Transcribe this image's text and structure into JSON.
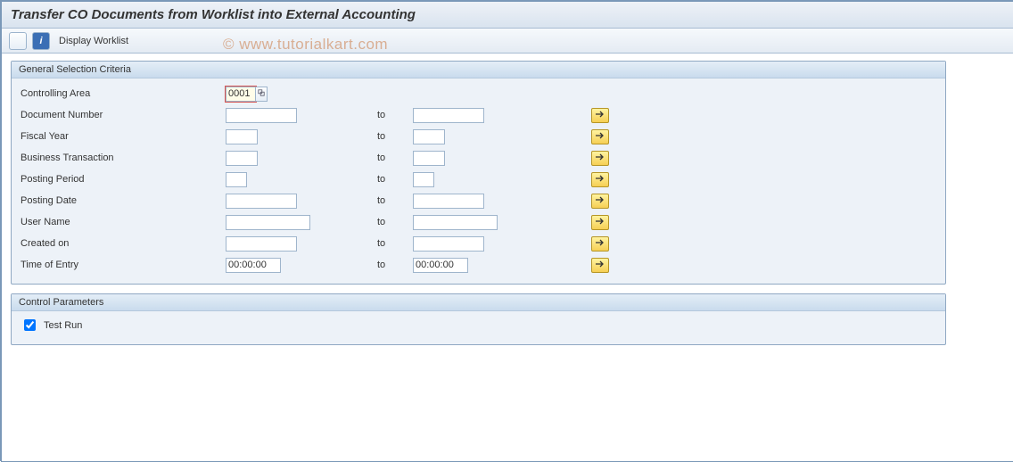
{
  "title": "Transfer CO Documents from Worklist into External Accounting",
  "watermark": "© www.tutorialkart.com",
  "toolbar": {
    "display_worklist": "Display Worklist"
  },
  "groups": {
    "general": {
      "title": "General Selection Criteria",
      "to_label": "to",
      "fields": {
        "controlling_area": {
          "label": "Controlling Area",
          "from": "0001"
        },
        "document_number": {
          "label": "Document Number",
          "from": "",
          "to": ""
        },
        "fiscal_year": {
          "label": "Fiscal Year",
          "from": "",
          "to": ""
        },
        "business_trans": {
          "label": "Business Transaction",
          "from": "",
          "to": ""
        },
        "posting_period": {
          "label": "Posting Period",
          "from": "",
          "to": ""
        },
        "posting_date": {
          "label": "Posting Date",
          "from": "",
          "to": ""
        },
        "user_name": {
          "label": "User Name",
          "from": "",
          "to": ""
        },
        "created_on": {
          "label": "Created on",
          "from": "",
          "to": ""
        },
        "time_of_entry": {
          "label": "Time of Entry",
          "from": "00:00:00",
          "to": "00:00:00"
        }
      }
    },
    "control": {
      "title": "Control Parameters",
      "test_run": {
        "label": "Test Run",
        "checked": true
      }
    }
  }
}
